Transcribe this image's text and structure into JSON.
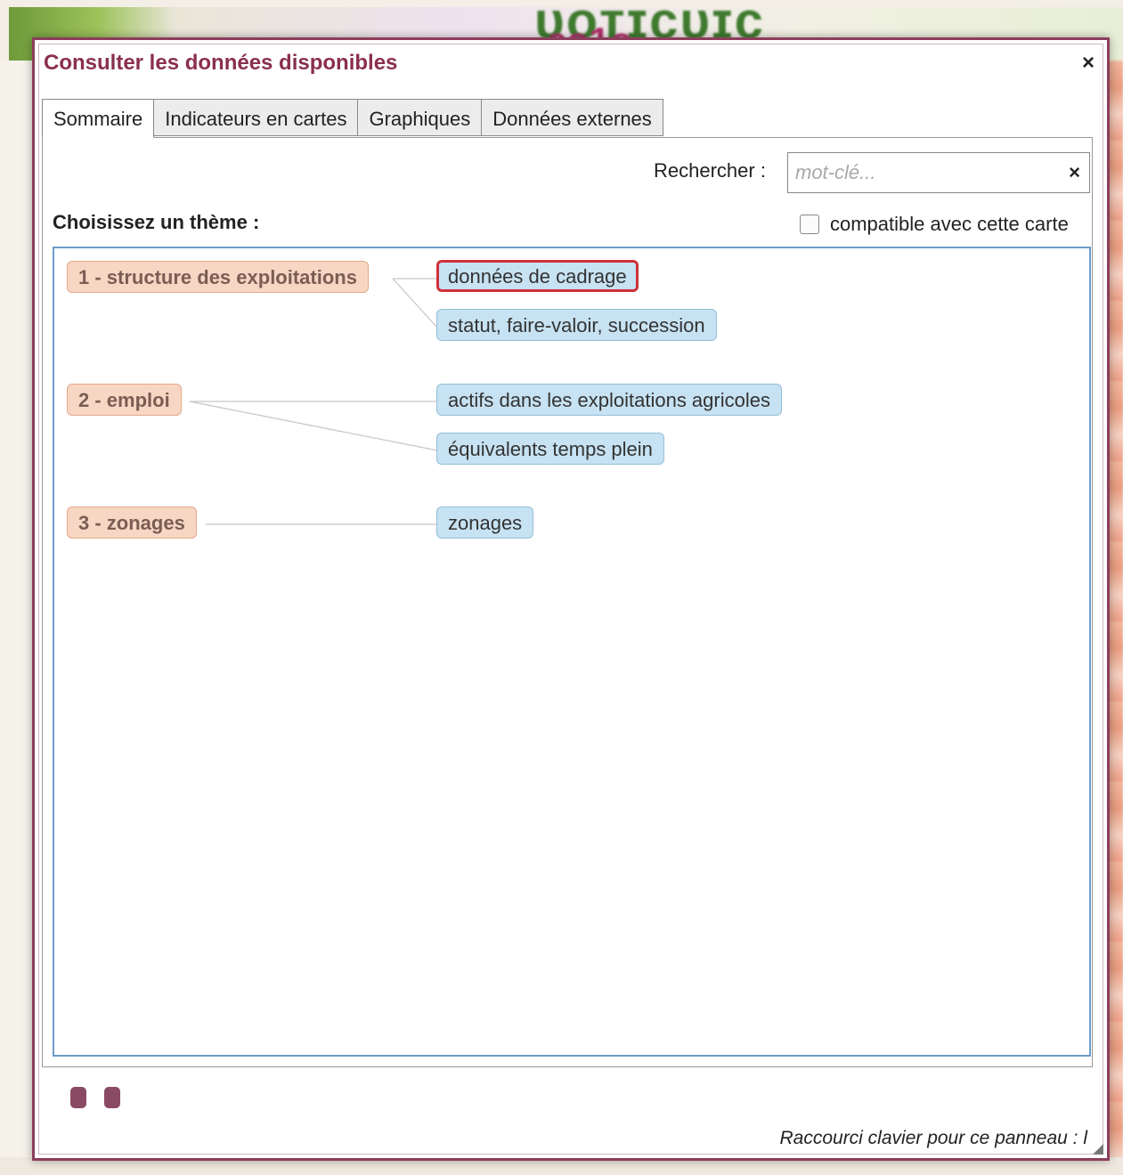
{
  "dialog": {
    "title": "Consulter les données disponibles",
    "close_glyph": "×"
  },
  "tabs": [
    {
      "label": "Sommaire",
      "active": true
    },
    {
      "label": "Indicateurs en cartes",
      "active": false
    },
    {
      "label": "Graphiques",
      "active": false
    },
    {
      "label": "Données externes",
      "active": false
    }
  ],
  "search": {
    "label": "Rechercher :",
    "placeholder": "mot-clé...",
    "value": "",
    "clear_glyph": "×"
  },
  "theme_label": "Choisissez un thème :",
  "compat_filter": {
    "label": "compatible avec cette carte",
    "checked": false
  },
  "themes": [
    {
      "label": "1 - structure des exploitations",
      "subs": [
        "données de cadrage",
        "statut, faire-valoir, succession"
      ]
    },
    {
      "label": "2 - emploi",
      "subs": [
        "actifs dans les exploitations agricoles",
        "équivalents temps plein"
      ]
    },
    {
      "label": "3 - zonages",
      "subs": [
        "zonages"
      ]
    }
  ],
  "selected_sub": "données de cadrage",
  "shortcut_text": "Raccourci clavier pour ce panneau : l",
  "colors": {
    "dialog_border": "#8c3d5c",
    "title": "#8a2f4f",
    "theme_bg": "#f8d6c4",
    "sub_bg": "#c7e2f2",
    "selected_outline": "#d0303a",
    "tree_border": "#6d9cc9"
  }
}
